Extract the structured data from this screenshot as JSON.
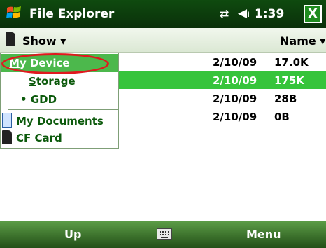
{
  "titlebar": {
    "title": "File Explorer",
    "connectivity_icon": "data-arrows-icon",
    "volume_icon": "speaker-icon",
    "clock": "1:39",
    "close_label": "X",
    "close_color": "#1f8c1f"
  },
  "toolbar": {
    "show_text": "Show",
    "show_underlined": "S",
    "show_rest": "how",
    "dropdown_arrow": "▾",
    "sort_label": "Name",
    "sort_arrow": "▾"
  },
  "files": [
    {
      "date": "2/10/09",
      "size": "17.0K",
      "selected": false
    },
    {
      "date": "2/10/09",
      "size": "175K",
      "selected": true
    },
    {
      "date": "2/10/09",
      "size": "28B",
      "selected": false
    },
    {
      "date": "2/10/09",
      "size": "0B",
      "selected": false
    }
  ],
  "menu": {
    "items": [
      {
        "u": "M",
        "rest": "y Device",
        "label": "My Device",
        "selected": true
      },
      {
        "u": "S",
        "rest": "torage",
        "label": "Storage",
        "selected": false
      },
      {
        "bullet": "•",
        "u": "G",
        "rest": "DD",
        "label": "GDD",
        "selected": false
      },
      {
        "label": "My Documents",
        "icon": "document-icon"
      },
      {
        "label": "CF Card",
        "icon": "cf-card-icon"
      }
    ]
  },
  "bottombar": {
    "left": "Up",
    "right": "Menu",
    "center_icon": "keyboard-icon"
  },
  "colors": {
    "titlebar": "#0f4a0f",
    "selection": "#36c43b",
    "menu_selection": "#4cb84c",
    "highlight_circle": "#e0181e"
  }
}
